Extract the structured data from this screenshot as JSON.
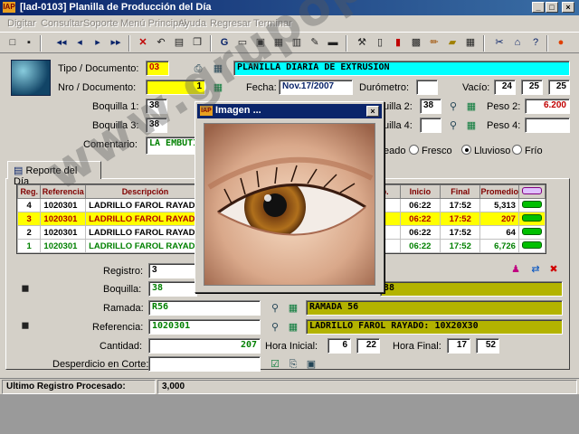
{
  "window": {
    "code": "[lad-0103]",
    "title": "Planilla de Producción del Día"
  },
  "menu": [
    "Digitar",
    "Consultar",
    "Soporte",
    "Menú Principal",
    "Ayuda",
    "Regresar",
    "Terminar"
  ],
  "form": {
    "tipo_label": "Tipo / Documento:",
    "tipo_value": "03",
    "tipo_desc": "PLANILLA DIARIA DE EXTRUSION",
    "nro_label": "Nro / Documento:",
    "nro_value": "1",
    "fecha_label": "Fecha:",
    "fecha_value": "Nov.17/2007",
    "durometro_label": "Durómetro:",
    "vacio_label": "Vacío:",
    "vacio_1": "24",
    "vacio_2": "25",
    "vacio_3": "25",
    "boquilla1_label": "Boquilla 1:",
    "boquilla1_value": "38",
    "boquilla3_label": "Boquilla 3:",
    "boquilla3_value": "38",
    "boquilla2_label": "uilla 2:",
    "boquilla2_value": "38",
    "boquilla4_label": "uilla 4:",
    "peso2_label": "Peso 2:",
    "peso2_value": "6.200",
    "peso4_label": "Peso 4:",
    "comentario_label": "Comentario:",
    "comentario_value": "LA EMBUTID",
    "clima_prefix": "eado",
    "clima_options": [
      "Fresco",
      "Lluvioso",
      "Frío"
    ],
    "clima_selected": 1
  },
  "tab": {
    "label": "Reporte del Día"
  },
  "grid": {
    "headers": [
      "Reg.",
      "Referencia",
      "Descripción",
      "p.",
      "Inicio",
      "Final",
      "Promedio",
      ""
    ],
    "rows": [
      {
        "reg": "4",
        "ref": "1020301",
        "desc": "LADRILLO FAROL RAYADO",
        "ini": "06:22",
        "fin": "17:52",
        "prom": "5,313"
      },
      {
        "reg": "3",
        "ref": "1020301",
        "desc": "LADRILLO FAROL RAYADO",
        "ini": "06:22",
        "fin": "17:52",
        "prom": "207"
      },
      {
        "reg": "2",
        "ref": "1020301",
        "desc": "LADRILLO FAROL RAYADO",
        "ini": "06:22",
        "fin": "17:52",
        "prom": "64"
      },
      {
        "reg": "1",
        "ref": "1020301",
        "desc": "LADRILLO FAROL RAYADO",
        "ini": "06:22",
        "fin": "17:52",
        "prom": "6,726"
      }
    ]
  },
  "detail": {
    "registro_label": "Registro:",
    "registro_value": "3",
    "boquilla_label": "Boquilla:",
    "boquilla_value": "38",
    "boquilla_desc": "38",
    "ramada_label": "Ramada:",
    "ramada_value": "R56",
    "ramada_desc": "RAMADA 56",
    "referencia_label": "Referencia:",
    "referencia_value": "1020301",
    "referencia_desc": "LADRILLO FAROL RAYADO: 10X20X30",
    "cantidad_label": "Cantidad:",
    "cantidad_value": "207",
    "hora_inicial_label": "Hora Inicial:",
    "hora_inicial_h": "6",
    "hora_inicial_m": "22",
    "hora_final_label": "Hora Final:",
    "hora_final_h": "17",
    "hora_final_m": "52",
    "desperdicio_label": "Desperdicio en Corte:"
  },
  "status": {
    "label": "Ultimo Registro Procesado:",
    "value": "3,000"
  },
  "dialog": {
    "title": "Imagen ..."
  },
  "watermark": "www.grupopo.com"
}
